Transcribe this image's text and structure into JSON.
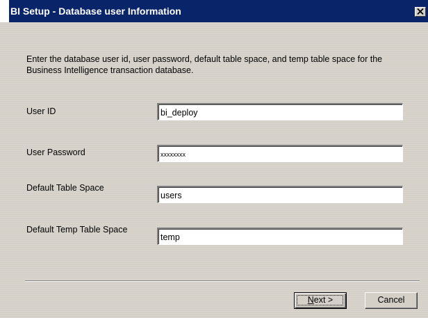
{
  "window": {
    "title": "BI Setup - Database user Information",
    "close_glyph": "✕"
  },
  "instructions": "Enter the database user id, user password, default table space, and temp table space for the Business Intelligence transaction database.",
  "fields": [
    {
      "label": "User ID",
      "value": "bi_deploy"
    },
    {
      "label": "User Password",
      "value": "xxxxxxxx"
    },
    {
      "label": "Default Table Space",
      "value": "users"
    },
    {
      "label": "Default Temp Table Space",
      "value": "temp"
    }
  ],
  "buttons": {
    "next_mnemonic": "N",
    "next_rest": "ext >",
    "cancel": "Cancel"
  },
  "icons": {
    "close": "close-icon"
  },
  "colors": {
    "titlebar": "#0a246a",
    "face": "#d4d0c8"
  }
}
